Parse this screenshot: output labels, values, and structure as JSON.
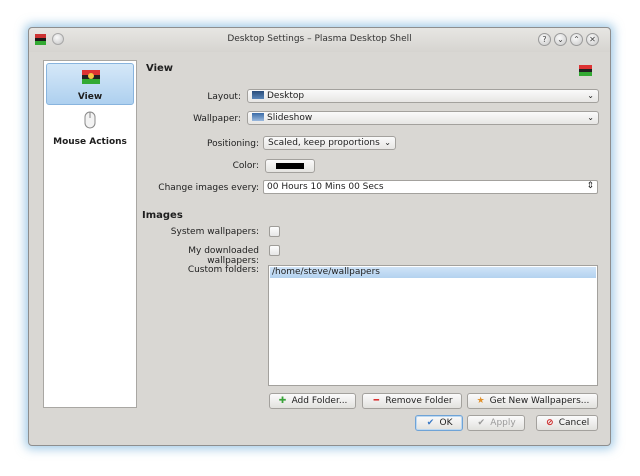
{
  "window": {
    "title": "Desktop Settings – Plasma Desktop Shell",
    "buttons": [
      "?",
      "⌄",
      "⌃",
      "✕"
    ]
  },
  "sidebar": {
    "items": [
      {
        "label": "View",
        "icon": "wallpaper-icon",
        "active": true
      },
      {
        "label": "Mouse Actions",
        "icon": "mouse-icon",
        "active": false
      }
    ]
  },
  "view": {
    "heading": "View",
    "layout": {
      "label": "Layout:",
      "value": "Desktop"
    },
    "wallpaper": {
      "label": "Wallpaper:",
      "value": "Slideshow"
    },
    "positioning": {
      "label": "Positioning:",
      "value": "Scaled, keep proportions"
    },
    "color": {
      "label": "Color:",
      "value": "#000000"
    },
    "change_every": {
      "label": "Change images every:",
      "value": "00 Hours 10 Mins 00 Secs"
    }
  },
  "images": {
    "heading": "Images",
    "system_wallpapers": {
      "label": "System wallpapers:",
      "checked": false
    },
    "downloaded_wallpapers": {
      "label": "My downloaded wallpapers:",
      "checked": false
    },
    "custom_folders": {
      "label": "Custom folders:",
      "items": [
        "/home/steve/wallpapers"
      ]
    },
    "add_folder": "Add Folder...",
    "remove_folder": "Remove Folder",
    "get_new": "Get New Wallpapers..."
  },
  "dialog": {
    "ok": "OK",
    "apply": "Apply",
    "cancel": "Cancel"
  },
  "colors": {
    "accent": "#aed0ef",
    "window_bg": "#d9d7d3",
    "add_icon": "#3aa33a",
    "remove_icon": "#d92a2a",
    "cancel_icon": "#cc2222"
  }
}
